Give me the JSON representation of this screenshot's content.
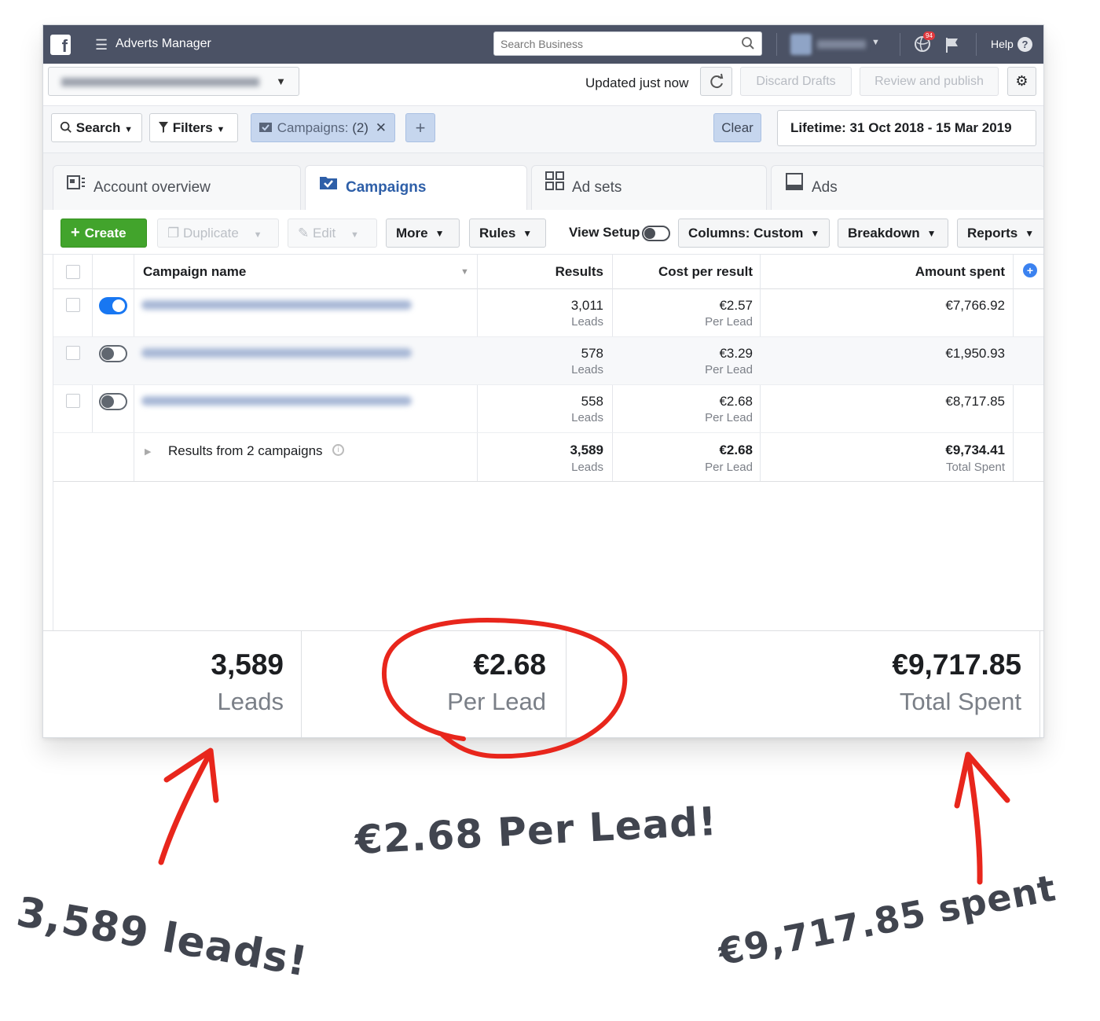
{
  "topbar": {
    "app_title": "Adverts Manager",
    "search_placeholder": "Search Business",
    "notification_count": "94",
    "help_label": "Help"
  },
  "toolbar": {
    "updated_text": "Updated just now",
    "discard_label": "Discard Drafts",
    "review_label": "Review and publish"
  },
  "filters": {
    "search_label": "Search",
    "filters_label": "Filters",
    "campaigns_chip": "Campaigns:",
    "campaigns_count": "(2)",
    "clear_label": "Clear",
    "date_range": "Lifetime: 31 Oct 2018 - 15 Mar 2019"
  },
  "tabs": [
    {
      "label": "Account overview",
      "icon": "account-overview-icon"
    },
    {
      "label": "Campaigns",
      "icon": "campaigns-folder-icon",
      "active": true
    },
    {
      "label": "Ad sets",
      "icon": "ad-sets-grid-icon"
    },
    {
      "label": "Ads",
      "icon": "ads-icon"
    }
  ],
  "actions": {
    "create": "Create",
    "duplicate": "Duplicate",
    "edit": "Edit",
    "more": "More",
    "rules": "Rules",
    "view_setup": "View Setup",
    "columns": "Columns: Custom",
    "breakdown": "Breakdown",
    "reports": "Reports"
  },
  "table": {
    "headers": {
      "campaign_name": "Campaign name",
      "results": "Results",
      "cost_per_result": "Cost per result",
      "amount_spent": "Amount spent"
    },
    "rows": [
      {
        "active": true,
        "results": "3,011",
        "results_unit": "Leads",
        "cost": "€2.57",
        "cost_unit": "Per Lead",
        "spent": "€7,766.92"
      },
      {
        "active": false,
        "results": "578",
        "results_unit": "Leads",
        "cost": "€3.29",
        "cost_unit": "Per Lead",
        "spent": "€1,950.93"
      },
      {
        "active": false,
        "results": "558",
        "results_unit": "Leads",
        "cost": "€2.68",
        "cost_unit": "Per Lead",
        "spent": "€8,717.85"
      }
    ],
    "total": {
      "label": "Results from 2 campaigns",
      "results": "3,589",
      "results_unit": "Leads",
      "cost": "€2.68",
      "cost_unit": "Per Lead",
      "spent": "€9,734.41",
      "spent_unit": "Total Spent"
    }
  },
  "summary": {
    "leads": "3,589",
    "leads_label": "Leads",
    "cost": "€2.68",
    "cost_label": "Per Lead",
    "spent": "€9,717.85",
    "spent_label": "Total Spent"
  },
  "annotations": {
    "leads_note": "3,589 leads!",
    "cost_note": "€2.68 Per Lead!",
    "spent_note": "€9,717.85 spent"
  },
  "colors": {
    "topbar": "#4b5265",
    "accent_blue": "#1877f2",
    "create_green": "#42a42c",
    "annotation_red": "#e8261c"
  }
}
